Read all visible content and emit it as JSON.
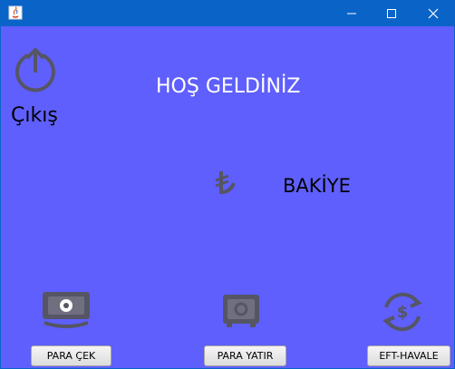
{
  "titlebar": {
    "title": "",
    "colors": {
      "bar": "#0a64c8",
      "content": "#5f5ffd"
    }
  },
  "main": {
    "welcome": "HOŞ GELDİNİZ",
    "exit_label": "Çıkış",
    "balance_label": "BAKİYE",
    "currency_icon": "turkish-lira-icon"
  },
  "actions": {
    "withdraw": {
      "label": "PARA ÇEK",
      "icon": "banknote-icon"
    },
    "deposit": {
      "label": "PARA YATIR",
      "icon": "safe-icon"
    },
    "transfer": {
      "label": "EFT-HAVALE",
      "icon": "dollar-exchange-icon"
    }
  }
}
